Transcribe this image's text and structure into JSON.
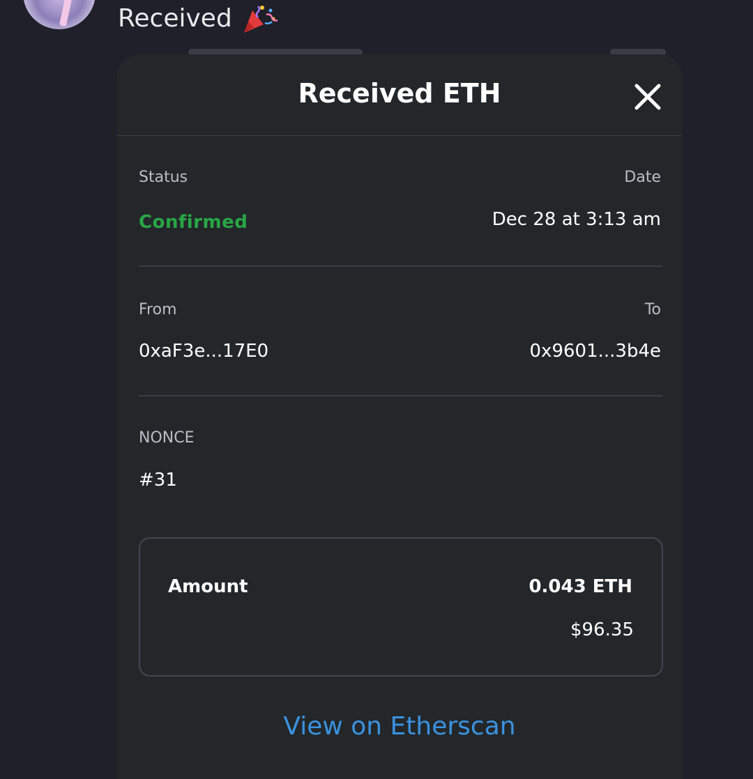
{
  "chat": {
    "message_text": "Received",
    "emoji_icon": "party-popper-icon"
  },
  "modal": {
    "title": "Received ETH",
    "close_icon": "close-icon",
    "status": {
      "label": "Status",
      "value": "Confirmed",
      "color": "#28a745"
    },
    "date": {
      "label": "Date",
      "value": "Dec 28 at 3:13 am"
    },
    "from": {
      "label": "From",
      "value": "0xaF3e...17E0"
    },
    "to": {
      "label": "To",
      "value": "0x9601...3b4e"
    },
    "nonce": {
      "label": "NONCE",
      "value": "#31"
    },
    "amount": {
      "label": "Amount",
      "eth_value": "0.043 ETH",
      "usd_value": "$96.35"
    },
    "etherscan_link": {
      "label": "View on Etherscan",
      "color": "#3a92e0"
    }
  },
  "colors": {
    "background": "#1f2029",
    "modal_background": "#24272a",
    "accent_link": "#3a92e0",
    "status_success": "#28a745"
  }
}
